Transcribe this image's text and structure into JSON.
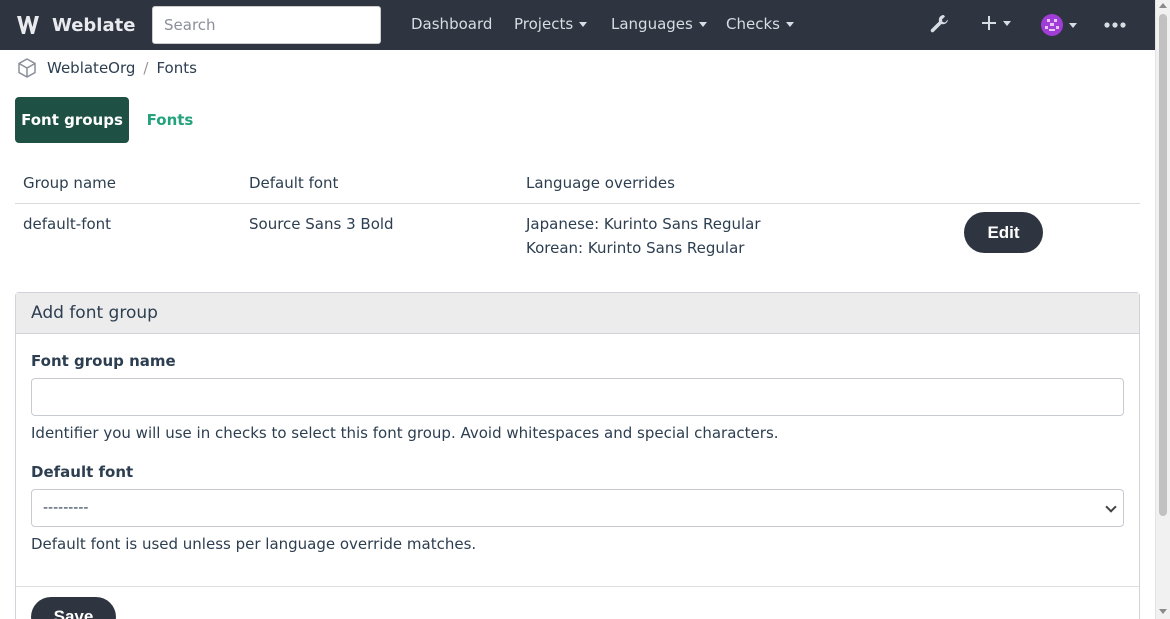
{
  "app": {
    "name": "Weblate"
  },
  "search": {
    "placeholder": "Search"
  },
  "nav": {
    "dashboard": "Dashboard",
    "projects": "Projects",
    "languages": "Languages",
    "checks": "Checks"
  },
  "icons": {
    "tools": "wrench-icon",
    "add": "plus-icon",
    "avatar": "avatar-icon",
    "more": "more-icon"
  },
  "breadcrumb": {
    "org": "WeblateOrg",
    "separator": "/",
    "current": "Fonts"
  },
  "tabs": {
    "active": "Font groups",
    "other": "Fonts"
  },
  "table": {
    "headers": [
      "Group name",
      "Default font",
      "Language overrides"
    ],
    "rows": [
      {
        "group_name": "default-font",
        "default_font": "Source Sans 3 Bold",
        "overrides": [
          "Japanese: Kurinto Sans Regular",
          "Korean: Kurinto Sans Regular"
        ],
        "action": "Edit"
      }
    ]
  },
  "form": {
    "title": "Add font group",
    "name_label": "Font group name",
    "name_value": "",
    "name_help": "Identifier you will use in checks to select this font group. Avoid whitespaces and special characters.",
    "font_label": "Default font",
    "font_selected": "---------",
    "font_help": "Default font is used unless per language override matches.",
    "submit": "Save"
  },
  "colors": {
    "navbar": "#2e3440",
    "tab_active": "#1e5043",
    "link": "#24a37c",
    "avatar": "#a03dd6"
  }
}
